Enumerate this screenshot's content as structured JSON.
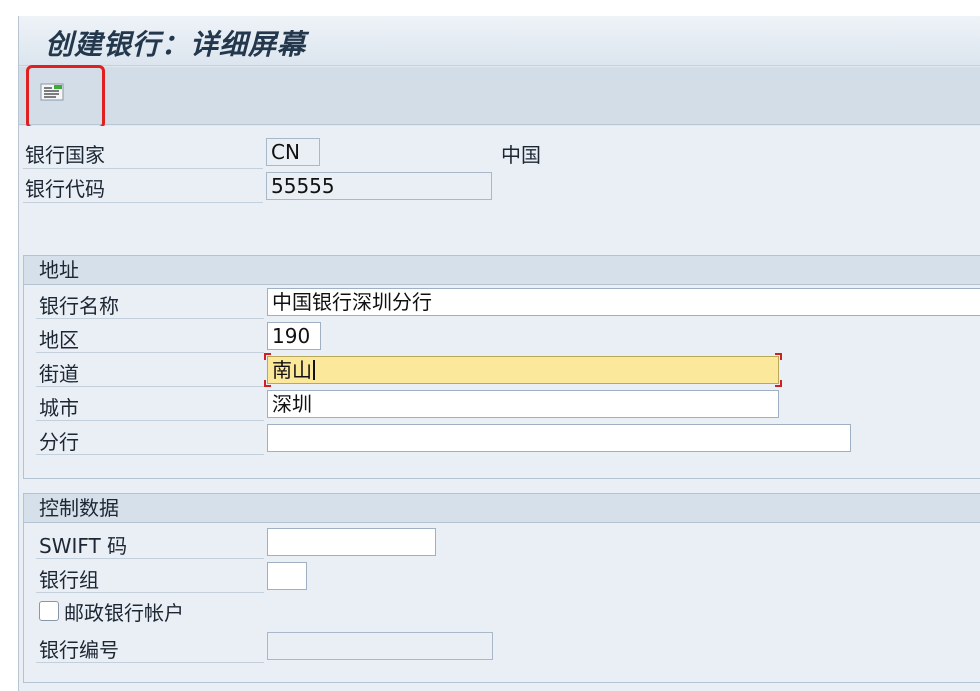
{
  "window": {
    "title": "创建银行：详细屏幕"
  },
  "toolbar": {
    "icon": "document-lines-icon"
  },
  "header_fields": {
    "country_label": "银行国家",
    "country_value": "CN",
    "country_name": "中国",
    "code_label": "银行代码",
    "code_value": "55555"
  },
  "address": {
    "title": "地址",
    "bank_name_label": "银行名称",
    "bank_name_value": "中国银行深圳分行",
    "region_label": "地区",
    "region_value": "190",
    "street_label": "街道",
    "street_value": "南山",
    "city_label": "城市",
    "city_value": "深圳",
    "branch_label": "分行",
    "branch_value": ""
  },
  "control": {
    "title": "控制数据",
    "swift_label": "SWIFT 码",
    "swift_value": "",
    "bank_group_label": "银行组",
    "bank_group_value": "",
    "postal_checkbox_label": "邮政银行帐户",
    "postal_checked": false,
    "bank_number_label": "银行编号",
    "bank_number_value": ""
  },
  "colors": {
    "highlight": "#e02020",
    "active_field": "#fce89a",
    "background": "#e9eff5"
  }
}
